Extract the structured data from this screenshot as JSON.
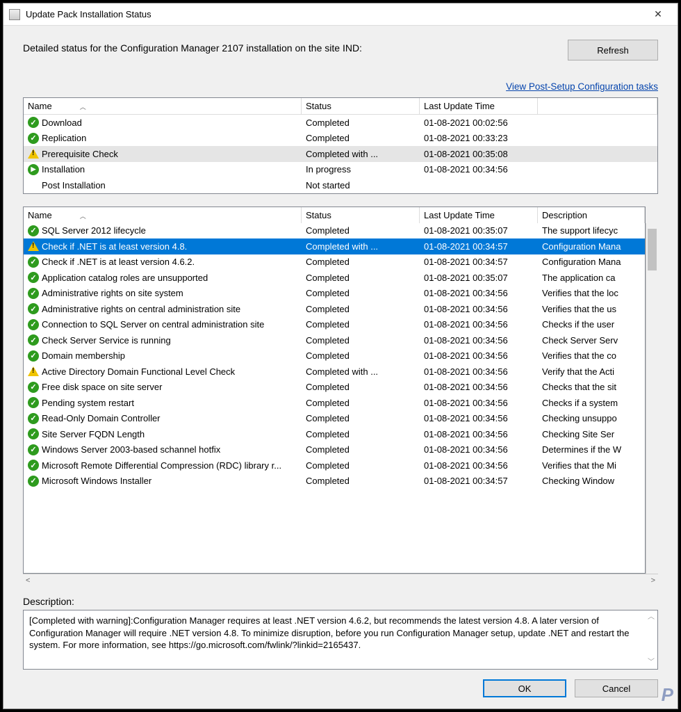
{
  "window": {
    "title": "Update Pack Installation Status"
  },
  "summary": "Detailed status for the Configuration Manager 2107 installation on the site IND:",
  "buttons": {
    "refresh": "Refresh",
    "ok": "OK",
    "cancel": "Cancel"
  },
  "link": {
    "post_setup": "View Post-Setup Configuration tasks"
  },
  "top_headers": {
    "name": "Name",
    "status": "Status",
    "time": "Last Update Time"
  },
  "bottom_headers": {
    "name": "Name",
    "status": "Status",
    "time": "Last Update Time",
    "description": "Description"
  },
  "top_rows": [
    {
      "icon": "success",
      "name": "Download",
      "status": "Completed",
      "time": "01-08-2021 00:02:56"
    },
    {
      "icon": "success",
      "name": "Replication",
      "status": "Completed",
      "time": "01-08-2021 00:33:23"
    },
    {
      "icon": "warning",
      "name": "Prerequisite Check",
      "status": "Completed with ...",
      "time": "01-08-2021 00:35:08",
      "highlight": true
    },
    {
      "icon": "progress",
      "name": "Installation",
      "status": "In progress",
      "time": "01-08-2021 00:34:56"
    },
    {
      "icon": "none",
      "name": "Post Installation",
      "status": "Not started",
      "time": ""
    }
  ],
  "bottom_rows": [
    {
      "icon": "success",
      "name": "SQL Server 2012 lifecycle",
      "status": "Completed",
      "time": "01-08-2021 00:35:07",
      "desc": "The support lifecyc"
    },
    {
      "icon": "warning",
      "name": "Check if .NET is at least version 4.8.",
      "status": "Completed with ...",
      "time": "01-08-2021 00:34:57",
      "desc": "Configuration Mana",
      "selected": true
    },
    {
      "icon": "success",
      "name": "Check if .NET is at least version 4.6.2.",
      "status": "Completed",
      "time": "01-08-2021 00:34:57",
      "desc": "Configuration Mana"
    },
    {
      "icon": "success",
      "name": "Application catalog roles are unsupported",
      "status": "Completed",
      "time": "01-08-2021 00:35:07",
      "desc": "The application ca"
    },
    {
      "icon": "success",
      "name": "Administrative rights on site system",
      "status": "Completed",
      "time": "01-08-2021 00:34:56",
      "desc": "Verifies that the loc"
    },
    {
      "icon": "success",
      "name": "Administrative rights on central administration site",
      "status": "Completed",
      "time": "01-08-2021 00:34:56",
      "desc": "Verifies that the us"
    },
    {
      "icon": "success",
      "name": "Connection to SQL Server on central administration site",
      "status": "Completed",
      "time": "01-08-2021 00:34:56",
      "desc": "Checks if the user"
    },
    {
      "icon": "success",
      "name": "Check Server Service is running",
      "status": "Completed",
      "time": "01-08-2021 00:34:56",
      "desc": "Check Server Serv"
    },
    {
      "icon": "success",
      "name": "Domain membership",
      "status": "Completed",
      "time": "01-08-2021 00:34:56",
      "desc": "Verifies that the co"
    },
    {
      "icon": "warning",
      "name": "Active Directory Domain Functional Level Check",
      "status": "Completed with ...",
      "time": "01-08-2021 00:34:56",
      "desc": "Verify that the Acti"
    },
    {
      "icon": "success",
      "name": "Free disk space on site server",
      "status": "Completed",
      "time": "01-08-2021 00:34:56",
      "desc": "Checks that the sit"
    },
    {
      "icon": "success",
      "name": "Pending system restart",
      "status": "Completed",
      "time": "01-08-2021 00:34:56",
      "desc": "Checks if a system"
    },
    {
      "icon": "success",
      "name": "Read-Only Domain Controller",
      "status": "Completed",
      "time": "01-08-2021 00:34:56",
      "desc": "Checking unsuppo"
    },
    {
      "icon": "success",
      "name": "Site Server FQDN Length",
      "status": "Completed",
      "time": "01-08-2021 00:34:56",
      "desc": "Checking Site Ser"
    },
    {
      "icon": "success",
      "name": "Windows Server 2003-based schannel hotfix",
      "status": "Completed",
      "time": "01-08-2021 00:34:56",
      "desc": "Determines if the W"
    },
    {
      "icon": "success",
      "name": "Microsoft Remote Differential Compression (RDC) library r...",
      "status": "Completed",
      "time": "01-08-2021 00:34:56",
      "desc": "Verifies that the Mi"
    },
    {
      "icon": "success",
      "name": "Microsoft Windows Installer",
      "status": "Completed",
      "time": "01-08-2021 00:34:57",
      "desc": "Checking Window"
    }
  ],
  "description": {
    "label": "Description:",
    "text": "[Completed with warning]:Configuration Manager requires at least .NET version 4.6.2, but recommends the latest version 4.8. A later version of Configuration Manager will require .NET version 4.8. To minimize disruption, before you run Configuration Manager setup, update .NET and restart the system. For more information, see https://go.microsoft.com/fwlink/?linkid=2165437."
  }
}
